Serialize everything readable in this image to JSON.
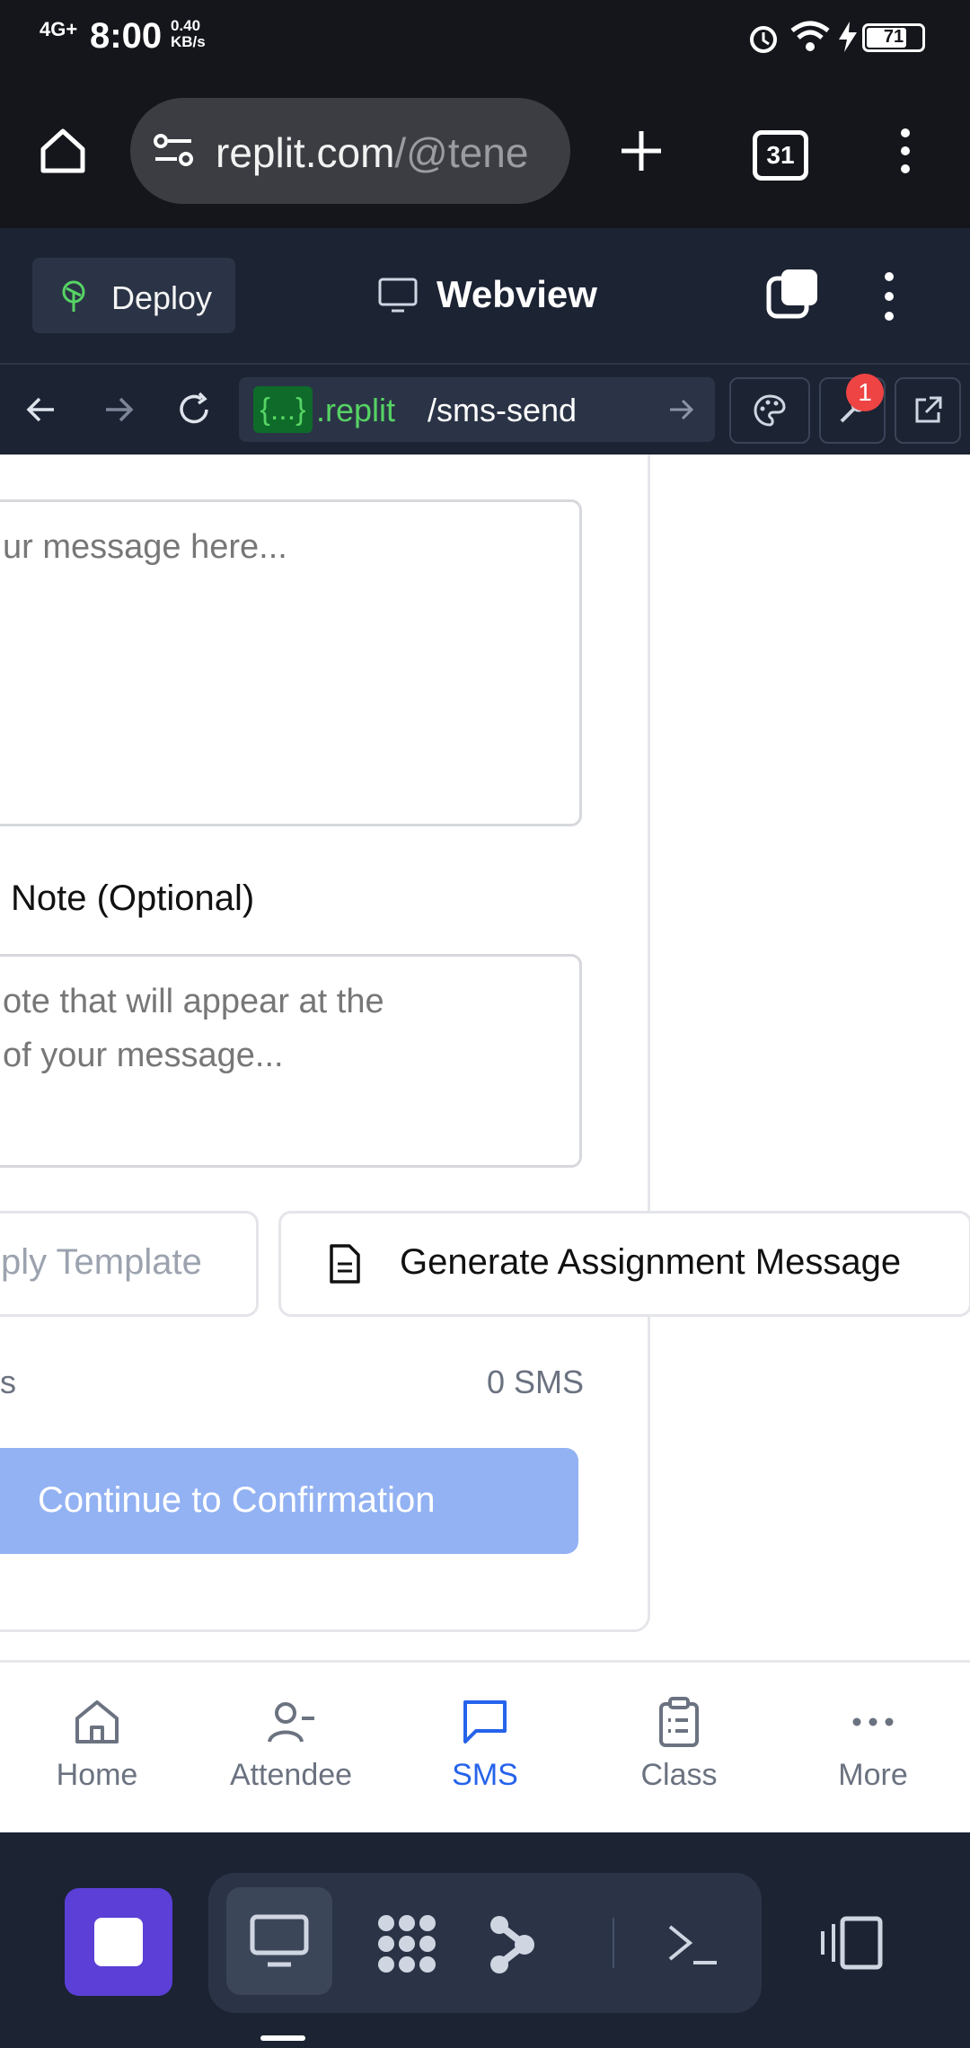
{
  "status_bar": {
    "network": "4G+",
    "time": "8:00",
    "speed_value": "0.40",
    "speed_unit": "KB/s",
    "battery": "71"
  },
  "browser": {
    "url_domain": "replit.com",
    "url_path": "/@tene",
    "tab_count": "31",
    "icons": [
      "home-icon",
      "site-settings-icon",
      "plus-icon",
      "tabs-icon",
      "more-vert-icon"
    ]
  },
  "replit_header": {
    "deploy_label": "Deploy",
    "webview_label": "Webview"
  },
  "nav_row": {
    "badge": "{...}",
    "host": ".replit",
    "route": "/sms-send",
    "notification_count": "1"
  },
  "form": {
    "message_placeholder": "ur message here...",
    "note_label": "Note (Optional)",
    "note_placeholder_line1": "ote that will appear at the",
    "note_placeholder_line2": "of your message...",
    "apply_template_label": "ply Template",
    "generate_label": "Generate Assignment Message",
    "count_left": "s",
    "count_right": "0 SMS",
    "continue_label": "Continue to Confirmation"
  },
  "bottom_nav": {
    "items": [
      {
        "label": "Home",
        "icon": "home-icon"
      },
      {
        "label": "Attendee",
        "icon": "user-minus-icon"
      },
      {
        "label": "SMS",
        "icon": "message-icon"
      },
      {
        "label": "Class",
        "icon": "clipboard-icon"
      },
      {
        "label": "More",
        "icon": "more-horizontal-icon"
      }
    ],
    "active": "SMS"
  },
  "colors": {
    "accent": "#2563eb",
    "primary_disabled": "#93b2f3",
    "replit_bg": "#1c2333",
    "stop_button": "#5b3fd6"
  }
}
